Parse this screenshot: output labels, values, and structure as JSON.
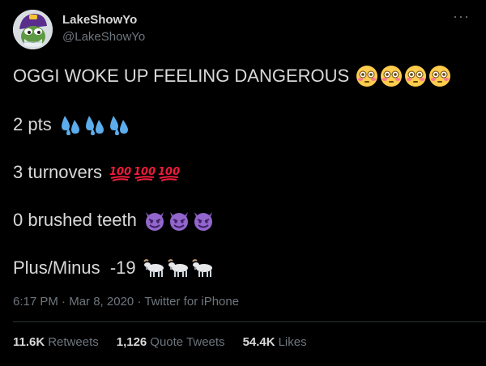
{
  "author": {
    "display_name": "LakeShowYo",
    "handle": "@LakeShowYo",
    "avatar_icon": "pepe-frog-purple-hat-avatar"
  },
  "more_icon": "···",
  "tweet": {
    "lines": [
      {
        "text": "OGGI WOKE UP FEELING DANGEROUS",
        "emoji": "flushed-face",
        "emoji_count": 4
      },
      {
        "text": "2 pts",
        "emoji": "sweat-droplets",
        "emoji_count": 3
      },
      {
        "text": "3 turnovers",
        "emoji": "hundred-points",
        "emoji_count": 3
      },
      {
        "text": "0 brushed teeth",
        "emoji": "smiling-imp",
        "emoji_count": 3
      },
      {
        "text": "Plus/Minus  -19",
        "emoji": "goat",
        "emoji_count": 3
      }
    ]
  },
  "meta": {
    "time": "6:17 PM",
    "separator": "·",
    "date": "Mar 8, 2020",
    "source": "Twitter for iPhone"
  },
  "stats": {
    "retweets_count": "11.6K",
    "retweets_label": "Retweets",
    "quotes_count": "1,126",
    "quotes_label": "Quote Tweets",
    "likes_count": "54.4K",
    "likes_label": "Likes"
  },
  "colors": {
    "background": "#000000",
    "text": "#d9d9d9",
    "secondary": "#6e767d",
    "divider": "#2f3336"
  }
}
